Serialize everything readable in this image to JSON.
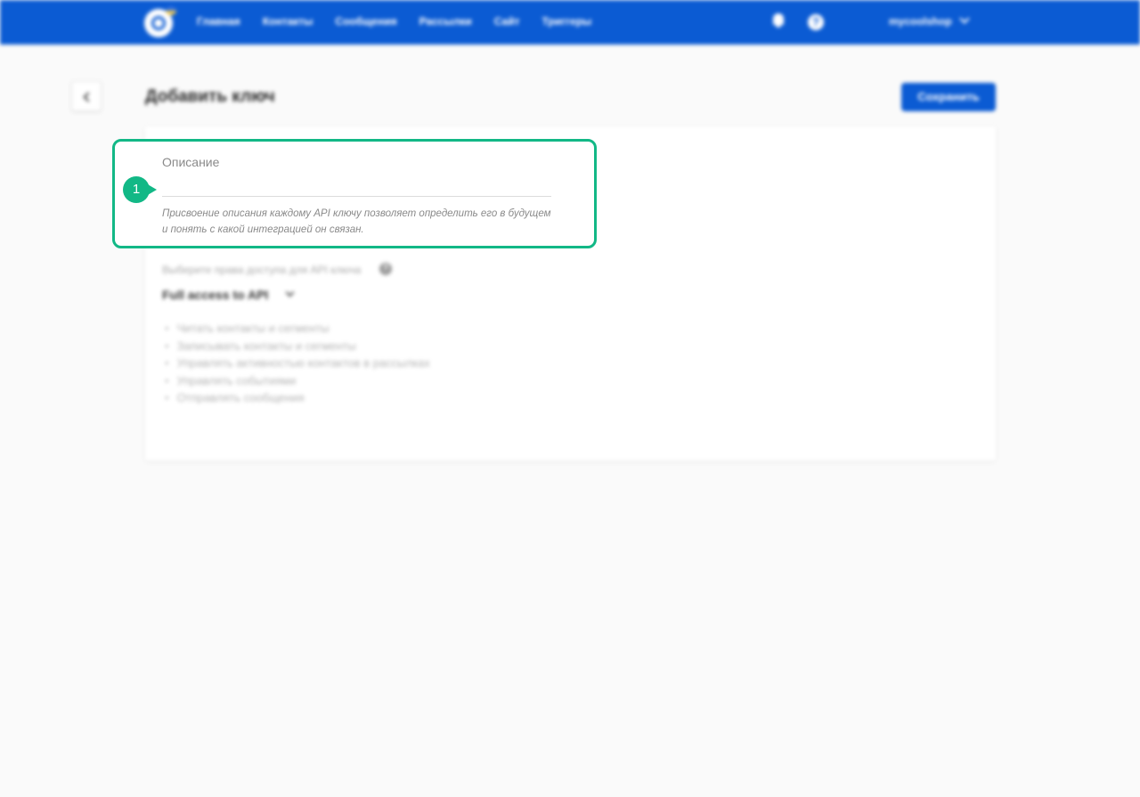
{
  "nav": {
    "items": [
      "Главная",
      "Контакты",
      "Сообщения",
      "Рассылки",
      "Сайт",
      "Триггеры"
    ],
    "account": "mycoolshop"
  },
  "header": {
    "title": "Добавить ключ",
    "save_label": "Сохранить"
  },
  "form": {
    "description_label": "Описание",
    "description_value": "",
    "description_hint": "Присвоение описания каждому API ключу позволяет определить его в будущем и понять с какой интеграцией он связан.",
    "permissions_label": "Выберите права доступа для API ключа",
    "access_level": "Full access to API",
    "permissions": [
      "Читать контакты и сегменты",
      "Записывать контакты и сегменты",
      "Управлять активностью контактов в рассылках",
      "Управлять событиями",
      "Отправлять сообщения"
    ]
  },
  "annotation": {
    "step": "1",
    "color": "#12b886"
  },
  "colors": {
    "brand": "#0b5bd3",
    "background": "#fafafa"
  }
}
